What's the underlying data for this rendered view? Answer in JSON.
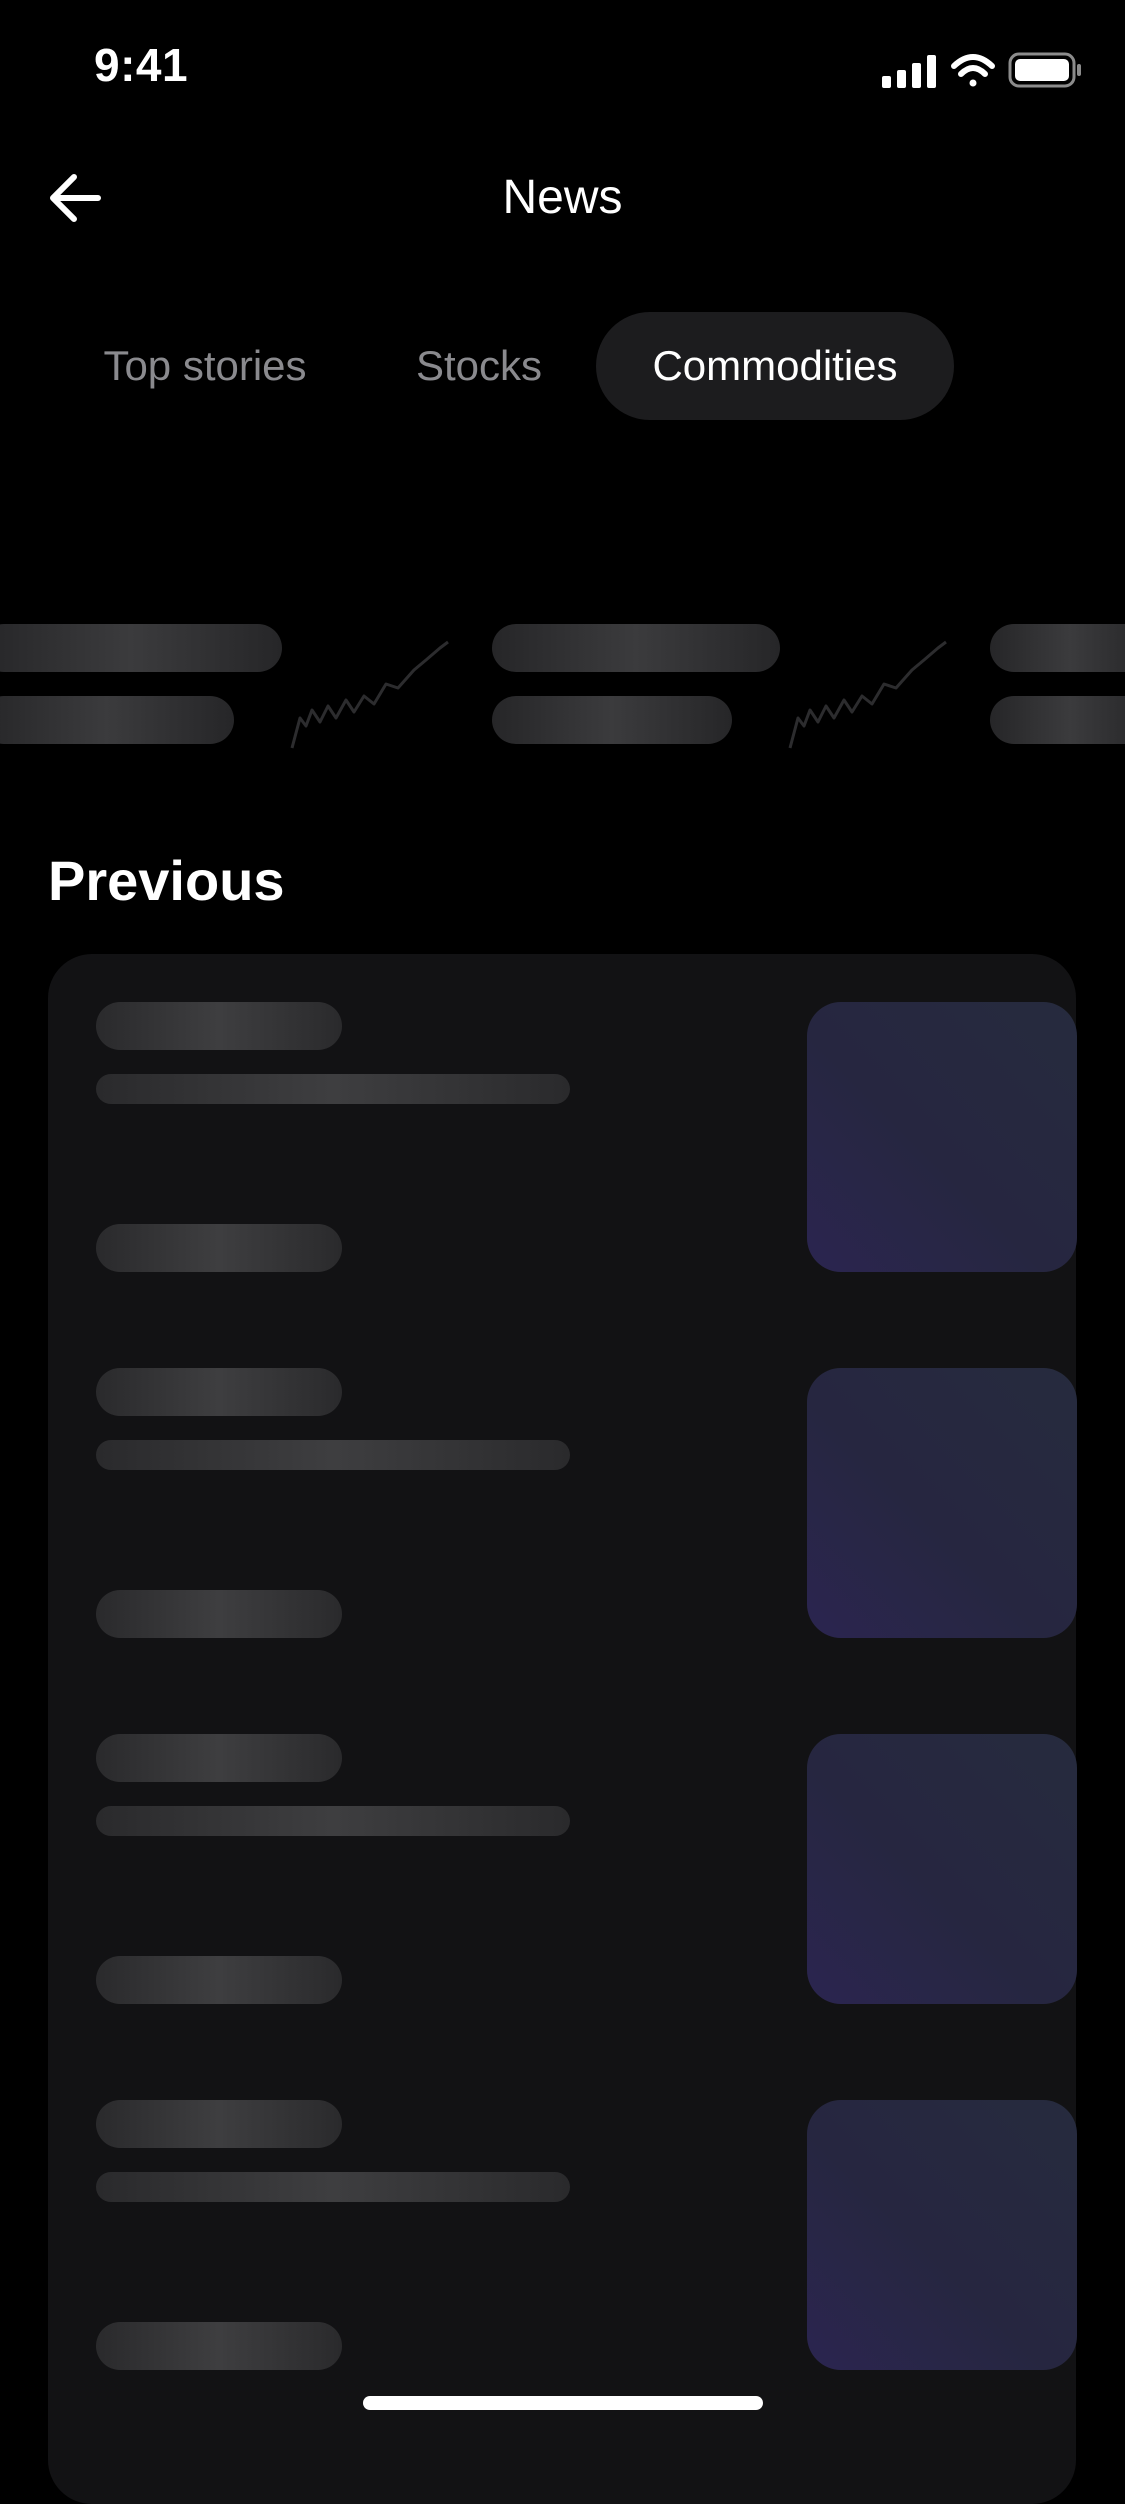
{
  "status_bar": {
    "time": "9:41"
  },
  "header": {
    "title": "News",
    "back_icon": "arrow-left-icon"
  },
  "tabs": [
    {
      "label": "Top stories",
      "active": false
    },
    {
      "label": "Stocks",
      "active": false
    },
    {
      "label": "Commodities",
      "active": true
    }
  ],
  "previous": {
    "title": "Previous"
  },
  "colors": {
    "background": "#000000",
    "card": "#121214",
    "active_tab": "#1c1c1e",
    "inactive_tab_text": "#8a8a8e",
    "thumbnail_tint": "#2b2550"
  }
}
